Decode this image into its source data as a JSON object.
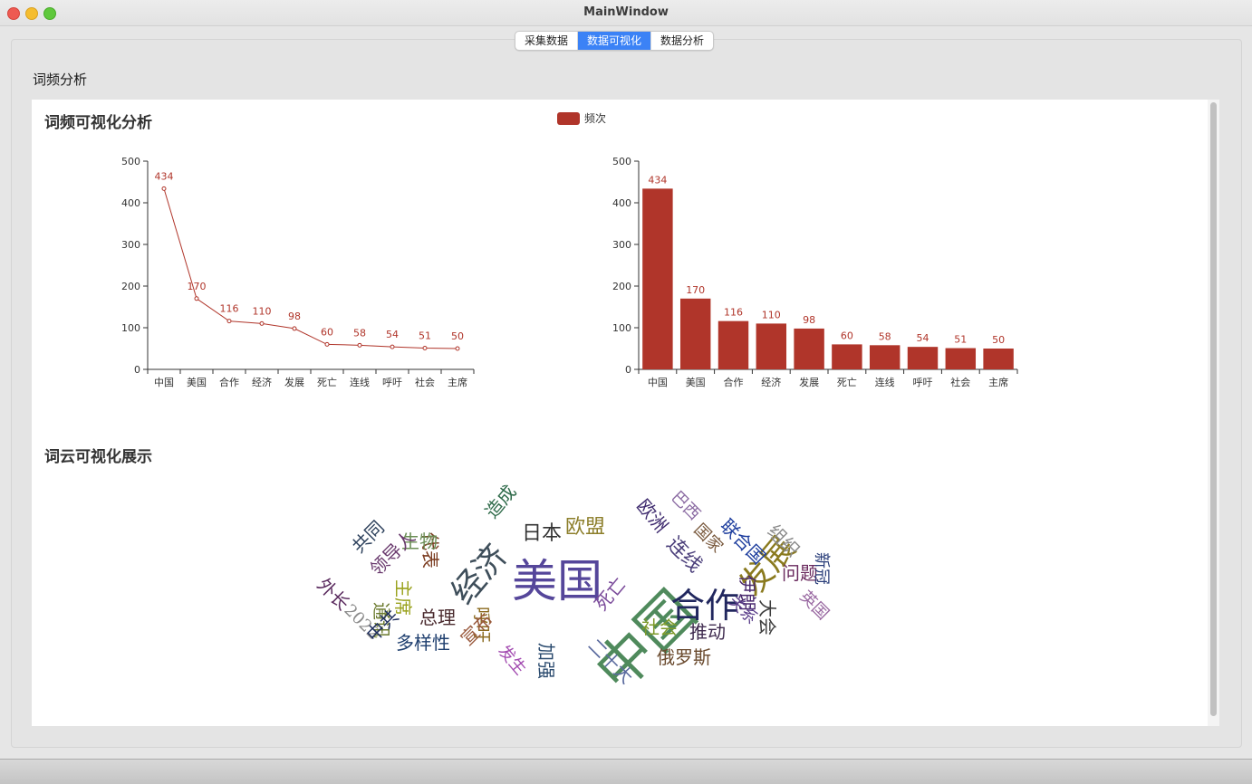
{
  "window": {
    "title": "MainWindow"
  },
  "tabs": [
    {
      "label": "采集数据",
      "active": false
    },
    {
      "label": "数据可视化",
      "active": true
    },
    {
      "label": "数据分析",
      "active": false
    }
  ],
  "section": {
    "title": "词频分析"
  },
  "freq": {
    "title": "词频可视化分析",
    "legend": "频次",
    "accent_color": "#b0352a"
  },
  "chart_data": [
    {
      "type": "line",
      "categories": [
        "中国",
        "美国",
        "合作",
        "经济",
        "发展",
        "死亡",
        "连线",
        "呼吁",
        "社会",
        "主席"
      ],
      "series": [
        {
          "name": "频次",
          "values": [
            434,
            170,
            116,
            110,
            98,
            60,
            58,
            54,
            51,
            50
          ]
        }
      ],
      "ylim": [
        0,
        500
      ],
      "yticks": [
        0,
        100,
        200,
        300,
        400,
        500
      ],
      "color": "#b0352a"
    },
    {
      "type": "bar",
      "categories": [
        "中国",
        "美国",
        "合作",
        "经济",
        "发展",
        "死亡",
        "连线",
        "呼吁",
        "社会",
        "主席"
      ],
      "series": [
        {
          "name": "频次",
          "values": [
            434,
            170,
            116,
            110,
            98,
            60,
            58,
            54,
            51,
            50
          ]
        }
      ],
      "ylim": [
        0,
        500
      ],
      "yticks": [
        0,
        100,
        200,
        300,
        400,
        500
      ],
      "color": "#b0352a"
    }
  ],
  "cloud": {
    "title": "词云可视化展示",
    "words": [
      {
        "text": "中国",
        "color": "#4f8a5c"
      },
      {
        "text": "美国",
        "color": "#55469a"
      },
      {
        "text": "合作",
        "color": "#21275e"
      },
      {
        "text": "发展",
        "color": "#8a7a1e"
      },
      {
        "text": "经济",
        "color": "#3e4e5a"
      },
      {
        "text": "日本",
        "color": "#333333"
      },
      {
        "text": "欧盟",
        "color": "#8c7e2a"
      },
      {
        "text": "代表",
        "color": "#7a3a1e"
      },
      {
        "text": "造成",
        "color": "#2f6b4a"
      },
      {
        "text": "生物",
        "color": "#6b8e55"
      },
      {
        "text": "共同",
        "color": "#2a3e5a"
      },
      {
        "text": "领导人",
        "color": "#6a3a6e"
      },
      {
        "text": "外长",
        "color": "#5a2a5e"
      },
      {
        "text": "2022",
        "color": "#8a8a8a"
      },
      {
        "text": "通讯",
        "color": "#6b7a2e"
      },
      {
        "text": "主席",
        "color": "#9aa21e"
      },
      {
        "text": "总理",
        "color": "#4a2a2e"
      },
      {
        "text": "呼吁",
        "color": "#8a6a1e"
      },
      {
        "text": "中共",
        "color": "#1e2e5e"
      },
      {
        "text": "多样性",
        "color": "#1e3e6e"
      },
      {
        "text": "宣布",
        "color": "#9a5a3e"
      },
      {
        "text": "发生",
        "color": "#a24ab0"
      },
      {
        "text": "加强",
        "color": "#2a4a6e"
      },
      {
        "text": "死亡",
        "color": "#7a4a9a"
      },
      {
        "text": "二十大",
        "color": "#5a6a9e"
      },
      {
        "text": "社会",
        "color": "#7e9a2a"
      },
      {
        "text": "推动",
        "color": "#3e2a4e"
      },
      {
        "text": "俄罗斯",
        "color": "#6a4a2e"
      },
      {
        "text": "欧洲",
        "color": "#3e2a6e"
      },
      {
        "text": "巴西",
        "color": "#8a6aa2"
      },
      {
        "text": "国家",
        "color": "#7a5a3e"
      },
      {
        "text": "连线",
        "color": "#4a3e7a"
      },
      {
        "text": "联合国",
        "color": "#1e3e9e"
      },
      {
        "text": "组织",
        "color": "#8a8a8a"
      },
      {
        "text": "问题",
        "color": "#6a2a5e"
      },
      {
        "text": "新冠",
        "color": "#2a3e7a"
      },
      {
        "text": "伊朗",
        "color": "#4a2a6e"
      },
      {
        "text": "关系",
        "color": "#5a3e8a"
      },
      {
        "text": "大会",
        "color": "#3e3e3e"
      },
      {
        "text": "英国",
        "color": "#9a6aa2"
      }
    ]
  }
}
